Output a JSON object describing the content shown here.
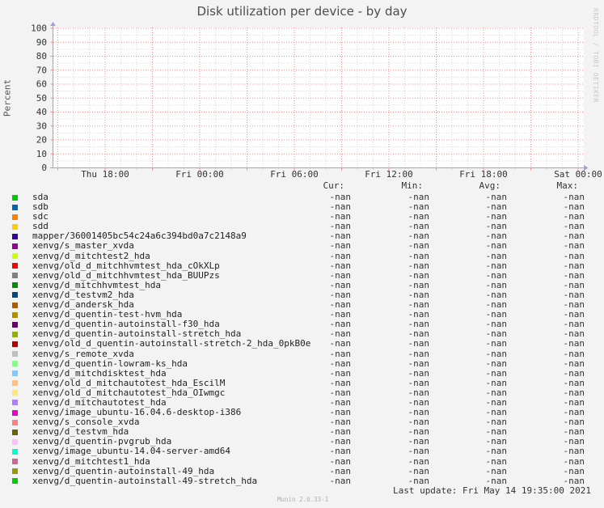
{
  "watermark": "RRDTOOL / TOBI OETIKER",
  "footer": {
    "last_update": "Last update: Fri May 14 19:35:00 2021",
    "version": "Munin 2.0.33-1"
  },
  "legend": {
    "headers": [
      "Cur:",
      "Min:",
      "Avg:",
      "Max:"
    ]
  },
  "colors": {
    "background": "#F3F3F3",
    "canvas": "#FFFFFF",
    "grid_minor": "#D6D6D6",
    "grid_major": "#FF8C8C",
    "axis": "#A0A0DC",
    "text": "#333333",
    "title_text": "#4d4d4d",
    "watermark_text": "#c9c9c9"
  },
  "chart_data": {
    "type": "line",
    "title": "Disk utilization per device - by day",
    "xlabel": "",
    "ylabel": "Percent",
    "ylim": [
      0,
      100
    ],
    "ytick_step": 10,
    "y_minor_step": 5,
    "grid": true,
    "legend_position": "bottom",
    "x_tick_labels": [
      "Thu 18:00",
      "Fri 00:00",
      "Fri 06:00",
      "Fri 12:00",
      "Fri 18:00",
      "Sat 00:00"
    ],
    "x_tick_hours": [
      0,
      6,
      12,
      18,
      24,
      30
    ],
    "x_major_step_hours": 3,
    "x_minor_step_hours": 1,
    "x_range_hours": [
      -3,
      30
    ],
    "values_note": "no data plotted; all series values are -nan",
    "series": [
      {
        "name": "sda",
        "color": "#00CC00",
        "cur": "-nan",
        "min": "-nan",
        "avg": "-nan",
        "max": "-nan",
        "values": []
      },
      {
        "name": "sdb",
        "color": "#0066B3",
        "cur": "-nan",
        "min": "-nan",
        "avg": "-nan",
        "max": "-nan",
        "values": []
      },
      {
        "name": "sdc",
        "color": "#FF8000",
        "cur": "-nan",
        "min": "-nan",
        "avg": "-nan",
        "max": "-nan",
        "values": []
      },
      {
        "name": "sdd",
        "color": "#FFCC00",
        "cur": "-nan",
        "min": "-nan",
        "avg": "-nan",
        "max": "-nan",
        "values": []
      },
      {
        "name": "mapper/36001405bc54c24a6c394bd0a7c2148a9",
        "color": "#330099",
        "cur": "-nan",
        "min": "-nan",
        "avg": "-nan",
        "max": "-nan",
        "values": []
      },
      {
        "name": "xenvg/s_master_xvda",
        "color": "#990099",
        "cur": "-nan",
        "min": "-nan",
        "avg": "-nan",
        "max": "-nan",
        "values": []
      },
      {
        "name": "xenvg/d_mitchtest2_hda",
        "color": "#CCFF00",
        "cur": "-nan",
        "min": "-nan",
        "avg": "-nan",
        "max": "-nan",
        "values": []
      },
      {
        "name": "xenvg/old_d_mitchhvmtest_hda_cOkXLp",
        "color": "#FF0000",
        "cur": "-nan",
        "min": "-nan",
        "avg": "-nan",
        "max": "-nan",
        "values": []
      },
      {
        "name": "xenvg/old_d_mitchhvmtest_hda_BUUPzs",
        "color": "#808080",
        "cur": "-nan",
        "min": "-nan",
        "avg": "-nan",
        "max": "-nan",
        "values": []
      },
      {
        "name": "xenvg/d_mitchhvmtest_hda",
        "color": "#008F00",
        "cur": "-nan",
        "min": "-nan",
        "avg": "-nan",
        "max": "-nan",
        "values": []
      },
      {
        "name": "xenvg/d_testvm2_hda",
        "color": "#00487D",
        "cur": "-nan",
        "min": "-nan",
        "avg": "-nan",
        "max": "-nan",
        "values": []
      },
      {
        "name": "xenvg/d_andersk_hda",
        "color": "#B35A00",
        "cur": "-nan",
        "min": "-nan",
        "avg": "-nan",
        "max": "-nan",
        "values": []
      },
      {
        "name": "xenvg/d_quentin-test-hvm_hda",
        "color": "#B38F00",
        "cur": "-nan",
        "min": "-nan",
        "avg": "-nan",
        "max": "-nan",
        "values": []
      },
      {
        "name": "xenvg/d_quentin-autoinstall-f30_hda",
        "color": "#6B006B",
        "cur": "-nan",
        "min": "-nan",
        "avg": "-nan",
        "max": "-nan",
        "values": []
      },
      {
        "name": "xenvg/d_quentin-autoinstall-stretch_hda",
        "color": "#8FB300",
        "cur": "-nan",
        "min": "-nan",
        "avg": "-nan",
        "max": "-nan",
        "values": []
      },
      {
        "name": "xenvg/old_d_quentin-autoinstall-stretch-2_hda_0pkB0e",
        "color": "#B30000",
        "cur": "-nan",
        "min": "-nan",
        "avg": "-nan",
        "max": "-nan",
        "values": []
      },
      {
        "name": "xenvg/s_remote_xvda",
        "color": "#BEBEBE",
        "cur": "-nan",
        "min": "-nan",
        "avg": "-nan",
        "max": "-nan",
        "values": []
      },
      {
        "name": "xenvg/d_quentin-lowram-ks_hda",
        "color": "#80FF80",
        "cur": "-nan",
        "min": "-nan",
        "avg": "-nan",
        "max": "-nan",
        "values": []
      },
      {
        "name": "xenvg/d_mitchdisktest_hda",
        "color": "#80C9FF",
        "cur": "-nan",
        "min": "-nan",
        "avg": "-nan",
        "max": "-nan",
        "values": []
      },
      {
        "name": "xenvg/old_d_mitchautotest_hda_EscilM",
        "color": "#FFC080",
        "cur": "-nan",
        "min": "-nan",
        "avg": "-nan",
        "max": "-nan",
        "values": []
      },
      {
        "name": "xenvg/old_d_mitchautotest_hda_OIwmgc",
        "color": "#FFE680",
        "cur": "-nan",
        "min": "-nan",
        "avg": "-nan",
        "max": "-nan",
        "values": []
      },
      {
        "name": "xenvg/d_mitchautotest_hda",
        "color": "#AA80FF",
        "cur": "-nan",
        "min": "-nan",
        "avg": "-nan",
        "max": "-nan",
        "values": []
      },
      {
        "name": "xenvg/image_ubuntu-16.04.6-desktop-i386",
        "color": "#EE00CC",
        "cur": "-nan",
        "min": "-nan",
        "avg": "-nan",
        "max": "-nan",
        "values": []
      },
      {
        "name": "xenvg/s_console_xvda",
        "color": "#FF8080",
        "cur": "-nan",
        "min": "-nan",
        "avg": "-nan",
        "max": "-nan",
        "values": []
      },
      {
        "name": "xenvg/d_testvm_hda",
        "color": "#666600",
        "cur": "-nan",
        "min": "-nan",
        "avg": "-nan",
        "max": "-nan",
        "values": []
      },
      {
        "name": "xenvg/d_quentin-pvgrub_hda",
        "color": "#FFBFFF",
        "cur": "-nan",
        "min": "-nan",
        "avg": "-nan",
        "max": "-nan",
        "values": []
      },
      {
        "name": "xenvg/image_ubuntu-14.04-server-amd64",
        "color": "#00FFCC",
        "cur": "-nan",
        "min": "-nan",
        "avg": "-nan",
        "max": "-nan",
        "values": []
      },
      {
        "name": "xenvg/d_mitchtest1_hda",
        "color": "#CC6699",
        "cur": "-nan",
        "min": "-nan",
        "avg": "-nan",
        "max": "-nan",
        "values": []
      },
      {
        "name": "xenvg/d_quentin-autoinstall-49_hda",
        "color": "#999900",
        "cur": "-nan",
        "min": "-nan",
        "avg": "-nan",
        "max": "-nan",
        "values": []
      },
      {
        "name": "xenvg/d_quentin-autoinstall-49-stretch_hda",
        "color": "#00CC00",
        "cur": "-nan",
        "min": "-nan",
        "avg": "-nan",
        "max": "-nan",
        "values": []
      }
    ]
  }
}
